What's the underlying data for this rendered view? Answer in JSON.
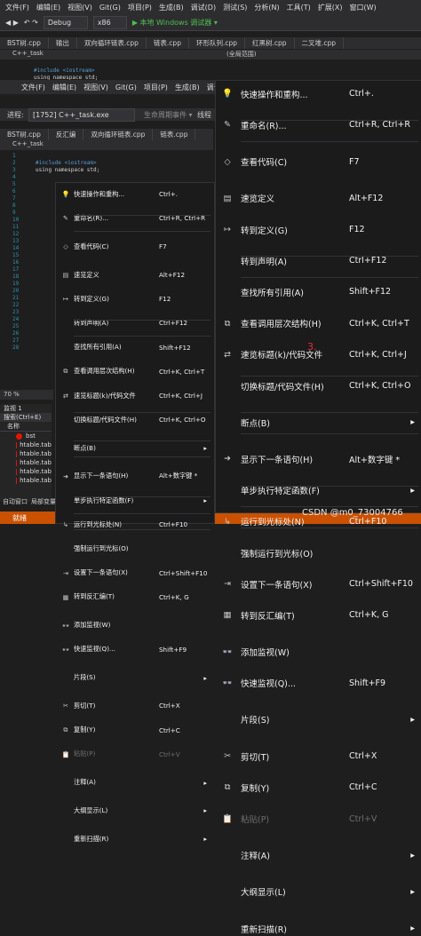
{
  "menu": [
    "文件(F)",
    "编辑(E)",
    "视图(V)",
    "Git(G)",
    "项目(P)",
    "生成(B)",
    "调试(D)",
    "测试(S)",
    "分析(N)",
    "工具(T)",
    "扩展(X)",
    "窗口(W)"
  ],
  "menu2": [
    "文件(F)",
    "编辑(E)",
    "视图(V)",
    "Git(G)",
    "项目(P)",
    "生成(B)",
    "调试(D)"
  ],
  "toolbar": {
    "config": "Debug",
    "platform": "x86",
    "run_label": "▶ 本地 Windows 调试器 ▾"
  },
  "tabs_top": [
    "BST树.cpp",
    "输出",
    "双向循环链表.cpp",
    "链表.cpp",
    "环形队列.cpp",
    "红黑树.cpp",
    "二叉堆.cpp"
  ],
  "tabs_mid": [
    "BST树.cpp",
    "反汇编",
    "双向循环链表.cpp",
    "链表.cpp"
  ],
  "process": {
    "label": "进程:",
    "value": "[1752] C++_task.exe",
    "events": "生命周期事件 ▾",
    "thread": "线程"
  },
  "project": "C++_task",
  "scope": "(全局范围)",
  "code": {
    "l1": "#include <iostream>",
    "l2": "using namespace std;"
  },
  "zoom": "70 %",
  "watch": {
    "title": "监视 1",
    "search": "搜索(Ctrl+E)",
    "col": "名称",
    "rows": [
      "bst",
      "htable.tab",
      "htable.tab",
      "htable.tab",
      "htable.tab",
      "htable.tab"
    ]
  },
  "bottom_tabs": [
    "自动窗口",
    "局部变量"
  ],
  "status": "就绪",
  "annotation": "3.",
  "watermark": "CSDN @m0_73004766",
  "ctx_menu": [
    {
      "icon": "bulb-icon",
      "glyph": "💡",
      "label": "快速操作和重构...",
      "shortcut": "Ctrl+."
    },
    {
      "icon": "rename-icon",
      "glyph": "✎",
      "label": "重命名(R)...",
      "shortcut": "Ctrl+R, Ctrl+R"
    },
    {
      "sep": true
    },
    {
      "icon": "code-icon",
      "glyph": "◇",
      "label": "查看代码(C)",
      "shortcut": "F7"
    },
    {
      "sep": true
    },
    {
      "icon": "peek-icon",
      "glyph": "▤",
      "label": "速览定义",
      "shortcut": "Alt+F12"
    },
    {
      "icon": "goto-def-icon",
      "glyph": "↦",
      "label": "转到定义(G)",
      "shortcut": "F12"
    },
    {
      "icon": "",
      "glyph": "",
      "label": "转到声明(A)",
      "shortcut": "Ctrl+F12"
    },
    {
      "icon": "",
      "glyph": "",
      "label": "查找所有引用(A)",
      "shortcut": "Shift+F12"
    },
    {
      "icon": "call-hierarchy-icon",
      "glyph": "⧉",
      "label": "查看调用层次结构(H)",
      "shortcut": "Ctrl+K, Ctrl+T"
    },
    {
      "icon": "header-icon",
      "glyph": "⇄",
      "label": "速览标题(k)/代码文件",
      "shortcut": "Ctrl+K, Ctrl+J"
    },
    {
      "icon": "",
      "glyph": "",
      "label": "切换标题/代码文件(H)",
      "shortcut": "Ctrl+K, Ctrl+O"
    },
    {
      "sep": true
    },
    {
      "icon": "",
      "glyph": "",
      "label": "断点(B)",
      "shortcut": "",
      "submenu": true
    },
    {
      "sep": true
    },
    {
      "icon": "next-statement-icon",
      "glyph": "➜",
      "label": "显示下一条语句(H)",
      "shortcut": "Alt+数字键 *"
    },
    {
      "icon": "",
      "glyph": "",
      "label": "单步执行特定函数(F)",
      "shortcut": "",
      "submenu": true
    },
    {
      "icon": "run-cursor-icon",
      "glyph": "↳",
      "label": "运行到光标处(N)",
      "shortcut": "Ctrl+F10"
    },
    {
      "icon": "",
      "glyph": "",
      "label": "强制运行到光标(O)",
      "shortcut": ""
    },
    {
      "icon": "set-next-icon",
      "glyph": "⇥",
      "label": "设置下一条语句(X)",
      "shortcut": "Ctrl+Shift+F10"
    },
    {
      "icon": "disasm-icon",
      "glyph": "▦",
      "label": "转到反汇编(T)",
      "shortcut": "Ctrl+K, G"
    },
    {
      "sep": true
    },
    {
      "icon": "watch-icon",
      "glyph": "👓",
      "label": "添加监视(W)",
      "shortcut": ""
    },
    {
      "icon": "quickwatch-icon",
      "glyph": "👓",
      "label": "快速监视(Q)...",
      "shortcut": "Shift+F9"
    },
    {
      "sep": true
    },
    {
      "icon": "",
      "glyph": "",
      "label": "片段(S)",
      "shortcut": "",
      "submenu": true
    },
    {
      "sep": true
    },
    {
      "icon": "cut-icon",
      "glyph": "✂",
      "label": "剪切(T)",
      "shortcut": "Ctrl+X"
    },
    {
      "icon": "copy-icon",
      "glyph": "⧉",
      "label": "复制(Y)",
      "shortcut": "Ctrl+C"
    },
    {
      "icon": "paste-icon",
      "glyph": "📋",
      "label": "粘贴(P)",
      "shortcut": "Ctrl+V",
      "disabled": true
    },
    {
      "sep": true
    },
    {
      "icon": "",
      "glyph": "",
      "label": "注释(A)",
      "shortcut": "",
      "submenu": true
    },
    {
      "sep": true
    },
    {
      "icon": "",
      "glyph": "",
      "label": "大纲显示(L)",
      "shortcut": "",
      "submenu": true
    },
    {
      "sep": true
    },
    {
      "icon": "",
      "glyph": "",
      "label": "重新扫描(R)",
      "shortcut": "",
      "submenu": true
    }
  ]
}
